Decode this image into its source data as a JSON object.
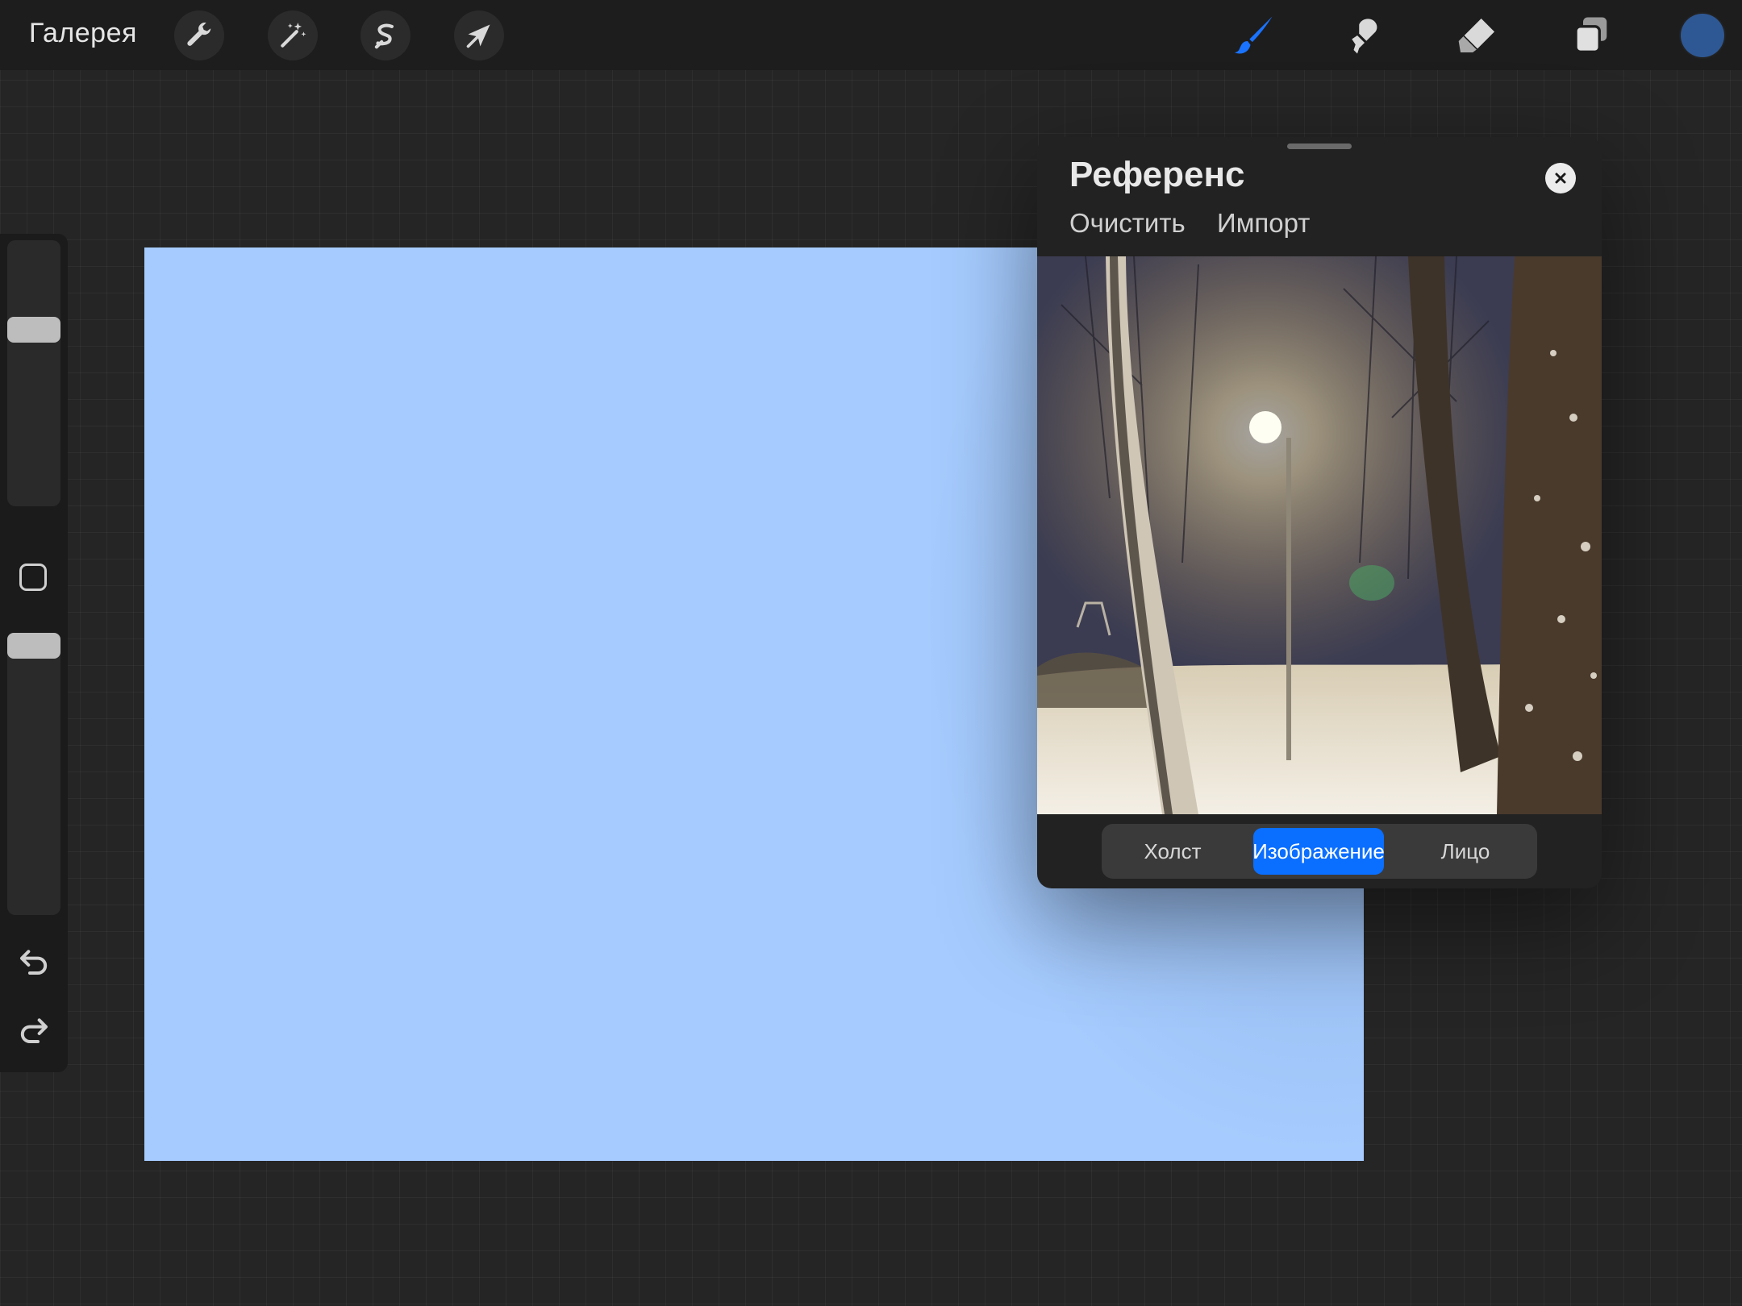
{
  "toolbar": {
    "gallery_label": "Галерея",
    "left_tools": [
      "wrench-icon",
      "magic-wand-icon",
      "selection-icon",
      "transform-arrow-icon"
    ],
    "right_tools": [
      "brush-icon",
      "smudge-icon",
      "eraser-icon",
      "layers-icon"
    ],
    "active_tool": "brush-icon",
    "current_color": "#2e5894",
    "accent_color": "#1a73ff"
  },
  "sidebar": {
    "brush_size_level": 0.68,
    "opacity_level": 1.0,
    "icons": [
      "modify-square-icon",
      "undo-icon",
      "redo-icon"
    ]
  },
  "canvas": {
    "fill_color": "#a6ccff"
  },
  "reference": {
    "title": "Референс",
    "clear_label": "Очистить",
    "import_label": "Импорт",
    "segments": [
      "Холст",
      "Изображение",
      "Лицо"
    ],
    "active_segment": "Изображение"
  }
}
